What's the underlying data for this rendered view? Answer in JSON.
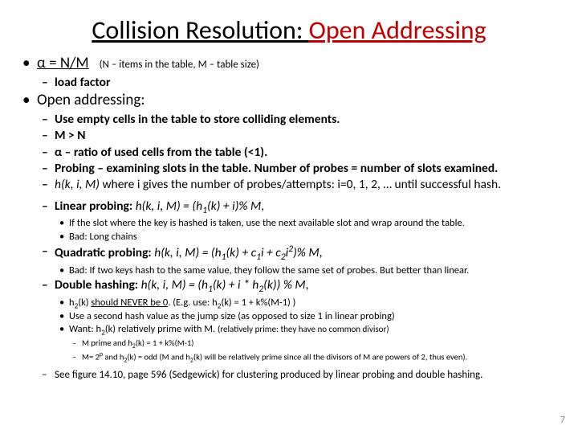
{
  "title": {
    "part1": "Collision Resolution: ",
    "part2": "Open Addressing"
  },
  "b1": {
    "eq": "α = N/M",
    "paren": "(N – items in the table, M – table size)",
    "sub": "load factor"
  },
  "b2": {
    "head": "Open addressing:",
    "s1": "Use empty cells in the table to store colliding elements.",
    "s2": "M > N",
    "s3": "α – ratio of used cells from the table (<1).",
    "s4": "Probing – examining slots in the table. Number of probes = number of slots examined.",
    "s5_a": "h(k, i, M)",
    "s5_b": " where i gives the number of probes/attempts: i=0, 1, 2, … until successful hash."
  },
  "lin": {
    "lead": "Linear probing: ",
    "expr_a": "h(k, i, M) = (h",
    "expr_b": "(k) + i)% M",
    "sub1": "If the slot where the key is hashed is taken, use the next available slot and wrap around the table.",
    "sub2": "Bad:  Long chains"
  },
  "quad": {
    "lead": "Quadratic probing: ",
    "expr_a": "h(k, i, M) = (h",
    "expr_b": "(k) + c",
    "expr_c": "i + c",
    "expr_d": "i",
    "expr_e": ")% M",
    "sub1": "Bad: If two keys hash to the same value, they follow the same set of probes. But better than linear."
  },
  "dbl": {
    "lead": "Double hashing: ",
    "expr_a": "h(k, i, M) = (h",
    "expr_b": "(k) + i * h",
    "expr_c": "(k)) % M",
    "s1_a": "h",
    "s1_b": "(k) ",
    "s1_c": "should NEVER be 0",
    "s1_d": ". (E.g. use: h",
    "s1_e": "(k) =  1 + k%(M-1) )",
    "s2": "Use a second hash value as the jump size (as opposed to size 1 in linear probing)",
    "s3_a": "Want: h",
    "s3_b": "(k) relatively prime with M.  ",
    "s3_c": "(relatively prime: they have no common divisor)",
    "n1_a": "M prime and h",
    "n1_b": "(k) =  1 + k%(M-1)",
    "n2_a": "M= 2",
    "n2_b": " and h",
    "n2_c": "(k) = odd  (M and h",
    "n2_d": "(k) will be relatively prime since all the divisors of M are powers of 2, thus even)."
  },
  "fig": "See figure 14.10, page 596 (Sedgewick) for clustering produced by linear probing and double hashing.",
  "page": "7"
}
